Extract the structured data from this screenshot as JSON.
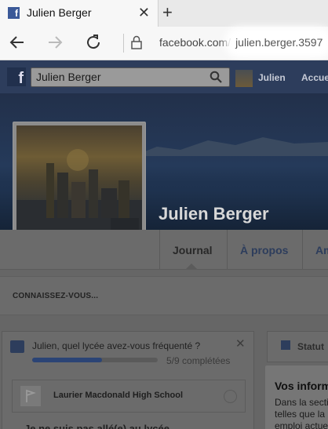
{
  "browser": {
    "tab_title": "Julien Berger",
    "tab_close": "✕",
    "new_tab": "+",
    "url_host": "facebook.com/",
    "url_path": "julien.berger.3597"
  },
  "fb": {
    "search_value": "Julien Berger",
    "user_name": "Julien",
    "home": "Accueil"
  },
  "profile": {
    "name": "Julien Berger",
    "tabs": [
      "Journal",
      "À propos",
      "Amis"
    ]
  },
  "know": {
    "heading": "CONNAISSEZ-VOUS..."
  },
  "school_card": {
    "question": "Julien, quel lycée avez-vous fréquenté ?",
    "progress_fraction": 0.5556,
    "progress_text": "5/9 complétées",
    "option": "Laurier Macdonald High School",
    "next_option": "Je ne suis pas allé(e) au lycée"
  },
  "status": {
    "label": "Statut"
  },
  "info_panel": {
    "title": "Vos informations",
    "lines": [
      "Dans la section",
      "telles que la",
      "emploi actuel"
    ]
  },
  "colors": {
    "fb_blue": "#2d3d5c",
    "progress": "#2b4475"
  }
}
